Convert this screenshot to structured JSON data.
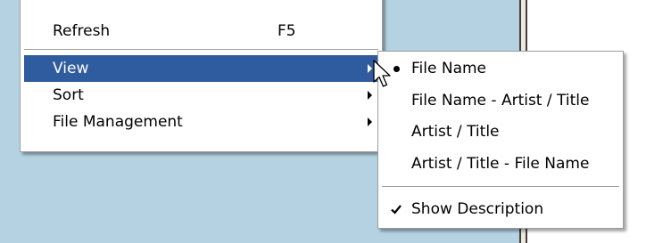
{
  "context_menu": {
    "items": [
      {
        "label": "Refresh",
        "shortcut": "F5"
      },
      {
        "label": "View"
      },
      {
        "label": "Sort"
      },
      {
        "label": "File Management"
      }
    ]
  },
  "view_submenu": {
    "items": [
      {
        "label": "File Name",
        "mark": "bullet-icon"
      },
      {
        "label": "File Name - Artist / Title"
      },
      {
        "label": "Artist / Title"
      },
      {
        "label": "Artist / Title - File Name"
      },
      {
        "label": "Show Description",
        "mark": "check-icon"
      }
    ]
  },
  "colors": {
    "highlight": "#2f5c9e",
    "background_panel": "#b4d2e2",
    "menu_background": "#ffffff"
  }
}
